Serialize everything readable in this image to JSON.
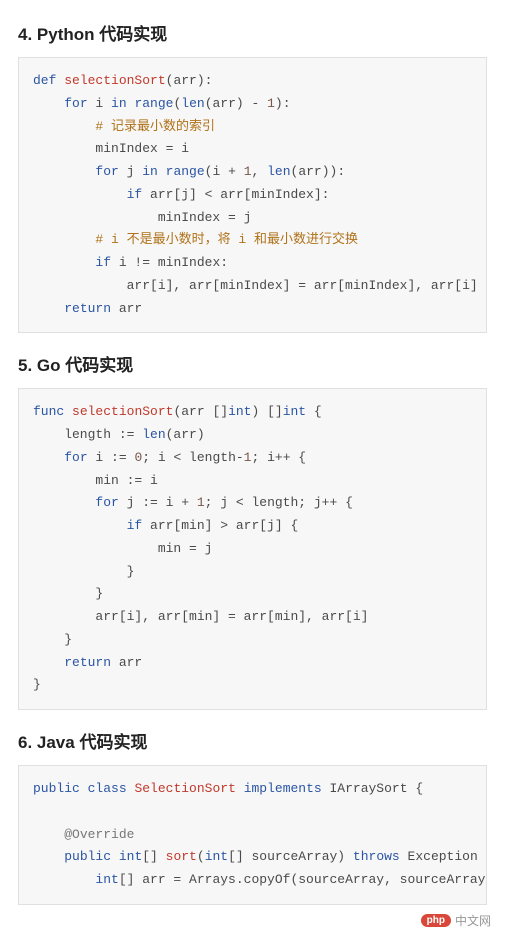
{
  "sections": {
    "python": {
      "heading": "4. Python 代码实现",
      "tokens": [
        {
          "c": "kw",
          "t": "def"
        },
        {
          "t": " "
        },
        {
          "c": "fn",
          "t": "selectionSort"
        },
        {
          "t": "(arr):"
        },
        {
          "t": "\n"
        },
        {
          "t": "    "
        },
        {
          "c": "kw",
          "t": "for"
        },
        {
          "t": " i "
        },
        {
          "c": "kw",
          "t": "in"
        },
        {
          "t": " "
        },
        {
          "c": "bi",
          "t": "range"
        },
        {
          "t": "("
        },
        {
          "c": "bi",
          "t": "len"
        },
        {
          "t": "(arr) - "
        },
        {
          "c": "num",
          "t": "1"
        },
        {
          "t": "):"
        },
        {
          "t": "\n"
        },
        {
          "t": "        "
        },
        {
          "c": "cm",
          "t": "# 记录最小数的索引"
        },
        {
          "t": "\n"
        },
        {
          "t": "        minIndex = i"
        },
        {
          "t": "\n"
        },
        {
          "t": "        "
        },
        {
          "c": "kw",
          "t": "for"
        },
        {
          "t": " j "
        },
        {
          "c": "kw",
          "t": "in"
        },
        {
          "t": " "
        },
        {
          "c": "bi",
          "t": "range"
        },
        {
          "t": "(i + "
        },
        {
          "c": "num",
          "t": "1"
        },
        {
          "t": ", "
        },
        {
          "c": "bi",
          "t": "len"
        },
        {
          "t": "(arr)):"
        },
        {
          "t": "\n"
        },
        {
          "t": "            "
        },
        {
          "c": "kw",
          "t": "if"
        },
        {
          "t": " arr[j] < arr[minIndex]:"
        },
        {
          "t": "\n"
        },
        {
          "t": "                minIndex = j"
        },
        {
          "t": "\n"
        },
        {
          "t": "        "
        },
        {
          "c": "cm",
          "t": "# i 不是最小数时，将 i 和最小数进行交换"
        },
        {
          "t": "\n"
        },
        {
          "t": "        "
        },
        {
          "c": "kw",
          "t": "if"
        },
        {
          "t": " i != minIndex:"
        },
        {
          "t": "\n"
        },
        {
          "t": "            arr[i], arr[minIndex] = arr[minIndex], arr[i]"
        },
        {
          "t": "\n"
        },
        {
          "t": "    "
        },
        {
          "c": "kw",
          "t": "return"
        },
        {
          "t": " arr"
        }
      ]
    },
    "go": {
      "heading": "5. Go 代码实现",
      "tokens": [
        {
          "c": "kw",
          "t": "func"
        },
        {
          "t": " "
        },
        {
          "c": "fn",
          "t": "selectionSort"
        },
        {
          "t": "(arr []"
        },
        {
          "c": "ty",
          "t": "int"
        },
        {
          "t": ") []"
        },
        {
          "c": "ty",
          "t": "int"
        },
        {
          "t": " {"
        },
        {
          "t": "\n"
        },
        {
          "t": "    length := "
        },
        {
          "c": "bi",
          "t": "len"
        },
        {
          "t": "(arr)"
        },
        {
          "t": "\n"
        },
        {
          "t": "    "
        },
        {
          "c": "kw",
          "t": "for"
        },
        {
          "t": " i := "
        },
        {
          "c": "num",
          "t": "0"
        },
        {
          "t": "; i < length-"
        },
        {
          "c": "num",
          "t": "1"
        },
        {
          "t": "; i++ {"
        },
        {
          "t": "\n"
        },
        {
          "t": "        min := i"
        },
        {
          "t": "\n"
        },
        {
          "t": "        "
        },
        {
          "c": "kw",
          "t": "for"
        },
        {
          "t": " j := i + "
        },
        {
          "c": "num",
          "t": "1"
        },
        {
          "t": "; j < length; j++ {"
        },
        {
          "t": "\n"
        },
        {
          "t": "            "
        },
        {
          "c": "kw",
          "t": "if"
        },
        {
          "t": " arr[min] > arr[j] {"
        },
        {
          "t": "\n"
        },
        {
          "t": "                min = j"
        },
        {
          "t": "\n"
        },
        {
          "t": "            }"
        },
        {
          "t": "\n"
        },
        {
          "t": "        }"
        },
        {
          "t": "\n"
        },
        {
          "t": "        arr[i], arr[min] = arr[min], arr[i]"
        },
        {
          "t": "\n"
        },
        {
          "t": "    }"
        },
        {
          "t": "\n"
        },
        {
          "t": "    "
        },
        {
          "c": "kw",
          "t": "return"
        },
        {
          "t": " arr"
        },
        {
          "t": "\n"
        },
        {
          "t": "}"
        }
      ]
    },
    "java": {
      "heading": "6. Java 代码实现",
      "tokens": [
        {
          "c": "kw",
          "t": "public"
        },
        {
          "t": " "
        },
        {
          "c": "kw",
          "t": "class"
        },
        {
          "t": " "
        },
        {
          "c": "cls",
          "t": "SelectionSort"
        },
        {
          "t": " "
        },
        {
          "c": "kw",
          "t": "implements"
        },
        {
          "t": " IArraySort {"
        },
        {
          "t": "\n"
        },
        {
          "t": "\n"
        },
        {
          "t": "    "
        },
        {
          "c": "an",
          "t": "@Override"
        },
        {
          "t": "\n"
        },
        {
          "t": "    "
        },
        {
          "c": "kw",
          "t": "public"
        },
        {
          "t": " "
        },
        {
          "c": "ty",
          "t": "int"
        },
        {
          "t": "[] "
        },
        {
          "c": "fn",
          "t": "sort"
        },
        {
          "t": "("
        },
        {
          "c": "ty",
          "t": "int"
        },
        {
          "t": "[] sourceArray) "
        },
        {
          "c": "kw",
          "t": "throws"
        },
        {
          "t": " Exception {"
        },
        {
          "t": "\n"
        },
        {
          "t": "        "
        },
        {
          "c": "ty",
          "t": "int"
        },
        {
          "t": "[] arr = Arrays.copyOf(sourceArray, sourceArray.length);"
        }
      ]
    }
  },
  "watermark": {
    "pill": "php",
    "text": "中文网"
  }
}
